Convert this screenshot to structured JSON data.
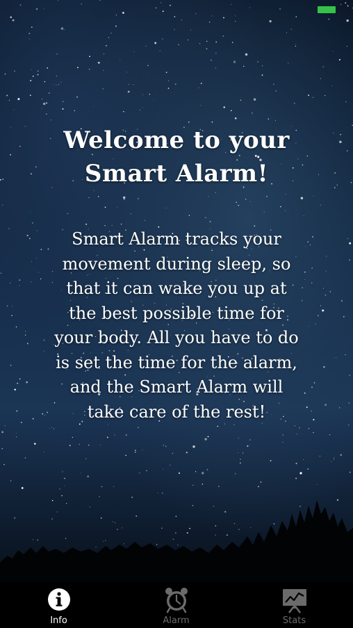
{
  "welcome": {
    "title_line1": "Welcome to your",
    "title_line2": "Smart Alarm!",
    "body_lines": [
      "Smart Alarm tracks your",
      "movement during sleep, so",
      "that it can wake you up at",
      "the best possible time for",
      "your body. All you have to do",
      "is set the time for the alarm,",
      "and the Smart Alarm will",
      "take care of the rest!"
    ]
  },
  "tab_bar": {
    "active_color": "#ffffff",
    "inactive_color": "#6b6b6b",
    "tabs": [
      {
        "label": "Info",
        "icon": "info-icon",
        "active": true
      },
      {
        "label": "Alarm",
        "icon": "alarm-clock-icon",
        "active": false
      },
      {
        "label": "Stats",
        "icon": "chart-board-icon",
        "active": false
      }
    ]
  },
  "status_bar": {
    "battery_color": "#36c24a"
  }
}
